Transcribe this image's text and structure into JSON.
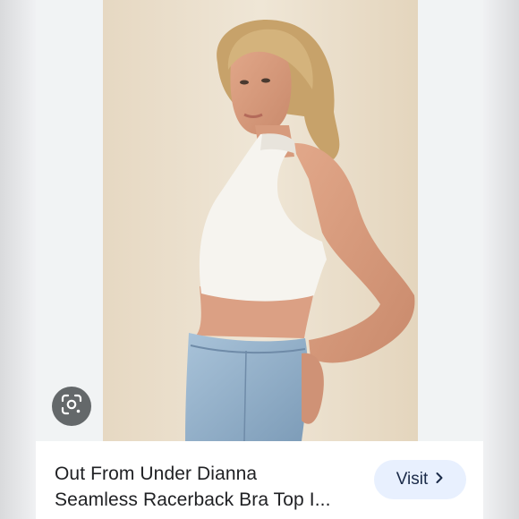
{
  "result": {
    "title_line_1": "Out From Under Dianna",
    "title_line_2": "Seamless Racerback Bra Top I...",
    "visit_label": "Visit"
  },
  "icons": {
    "lens": "google-lens-icon",
    "visit_arrow": "chevron-right-icon"
  },
  "colors": {
    "visit_button_bg": "#e8f0fe",
    "lens_button_bg": "#3c4043",
    "title_text": "#202124"
  }
}
